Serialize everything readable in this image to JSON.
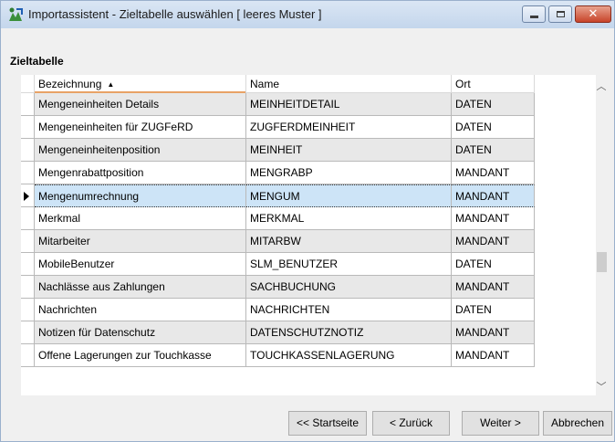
{
  "window": {
    "title": "Importassistent - Zieltabelle auswählen [ leeres Muster ]"
  },
  "section_label": "Zieltabelle",
  "table": {
    "columns": [
      "Bezeichnung",
      "Name",
      "Ort"
    ],
    "sort_indicator": "▲",
    "rows": [
      {
        "bezeichnung": "Mengeneinheiten Details",
        "name": "MEINHEITDETAIL",
        "ort": "DATEN"
      },
      {
        "bezeichnung": "Mengeneinheiten für ZUGFeRD",
        "name": "ZUGFERDMEINHEIT",
        "ort": "DATEN"
      },
      {
        "bezeichnung": "Mengeneinheitenposition",
        "name": "MEINHEIT",
        "ort": "DATEN"
      },
      {
        "bezeichnung": "Mengenrabattposition",
        "name": "MENGRABP",
        "ort": "MANDANT"
      },
      {
        "bezeichnung": "Mengenumrechnung",
        "name": "MENGUM",
        "ort": "MANDANT",
        "selected": true
      },
      {
        "bezeichnung": "Merkmal",
        "name": "MERKMAL",
        "ort": "MANDANT"
      },
      {
        "bezeichnung": "Mitarbeiter",
        "name": "MITARBW",
        "ort": "MANDANT"
      },
      {
        "bezeichnung": "MobileBenutzer",
        "name": "SLM_BENUTZER",
        "ort": "DATEN"
      },
      {
        "bezeichnung": "Nachlässe aus Zahlungen",
        "name": "SACHBUCHUNG",
        "ort": "MANDANT"
      },
      {
        "bezeichnung": "Nachrichten",
        "name": "NACHRICHTEN",
        "ort": "DATEN"
      },
      {
        "bezeichnung": "Notizen für Datenschutz",
        "name": "DATENSCHUTZNOTIZ",
        "ort": "MANDANT"
      },
      {
        "bezeichnung": "Offene Lagerungen zur Touchkasse",
        "name": "TOUCHKASSENLAGERUNG",
        "ort": "MANDANT"
      }
    ]
  },
  "buttons": {
    "start": "<< Startseite",
    "back": "< Zurück",
    "next": "Weiter >",
    "cancel": "Abbrechen"
  },
  "icons": {
    "app": "import-wizard-icon",
    "minimize": "minimize-icon",
    "maximize": "maximize-icon",
    "close": "close-icon",
    "row_indicator": "current-row-arrow-icon",
    "scroll_up": "chevron-up-icon",
    "scroll_down": "chevron-down-icon"
  },
  "colors": {
    "selection": "#cde4f7",
    "alt_row": "#e8e8e8",
    "sort_accent": "#e8a266",
    "close_button": "#c8442a"
  }
}
